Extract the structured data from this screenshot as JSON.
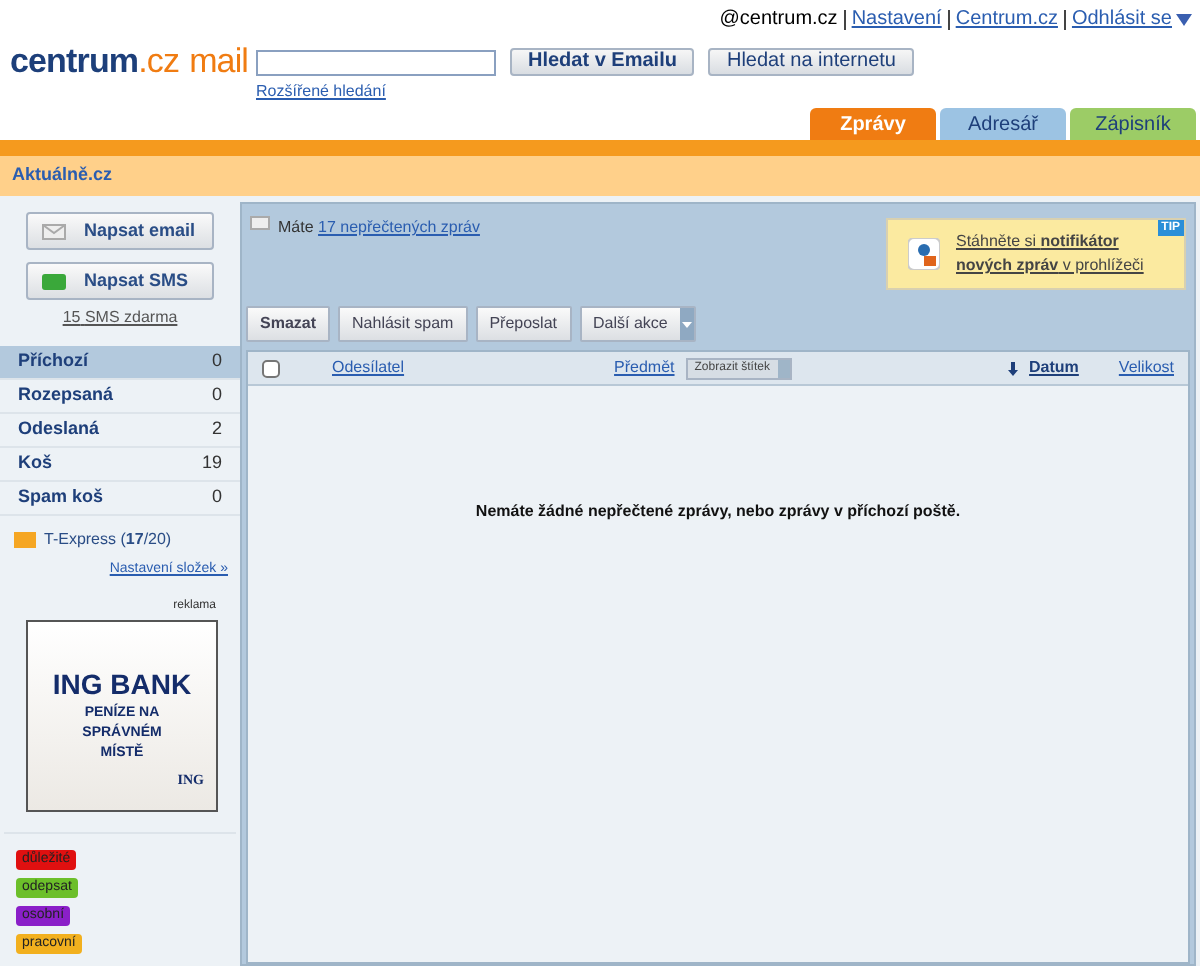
{
  "top_links": [
    {
      "label": "@centrum.cz",
      "kind": "account"
    },
    {
      "label": "Nastavení",
      "kind": "link"
    },
    {
      "label": "Centrum.cz",
      "kind": "link"
    },
    {
      "label": "Odhlásit se",
      "kind": "menu"
    }
  ],
  "logo": {
    "brand": "centrum",
    "domain": ".cz",
    "product": "mail"
  },
  "search": {
    "buttons": [
      "Hledat v Emailu",
      "Hledat na internetu"
    ],
    "advanced": "Rozšířené hledání"
  },
  "tabs": [
    {
      "label": "Zprávy",
      "selected": true,
      "color": "#f07c12"
    },
    {
      "label": "Adresář",
      "selected": false,
      "color": "#9cc3e3"
    },
    {
      "label": "Zápisník",
      "selected": false,
      "color": "#9ccc66"
    }
  ],
  "news_bar": "Aktuálně.cz",
  "compose": [
    {
      "label": "Napsat email",
      "kind": "email"
    },
    {
      "label": "Napsat SMS",
      "kind": "sms"
    }
  ],
  "sms_note": {
    "count": "15",
    "text": "SMS zdarma"
  },
  "folders": [
    {
      "name": "Příchozí",
      "count": "0",
      "selected": true
    },
    {
      "name": "Rozepsaná",
      "count": "0",
      "selected": false
    },
    {
      "name": "Odeslaná",
      "count": "2",
      "selected": false
    },
    {
      "name": "Koš",
      "count": "19",
      "selected": false
    },
    {
      "name": "Spam koš",
      "count": "0",
      "selected": false
    }
  ],
  "custom_folder": {
    "label": "T-Express (**17**/20)"
  },
  "folder_settings": "Nastavení složek »",
  "ad": {
    "label": "reklama",
    "title": "ING BANK",
    "subtitle": "PENÍZE NA SPRÁVNÉM MÍSTĚ",
    "logo": "ING"
  },
  "labels": [
    {
      "name": "důležité",
      "color": "#e01010"
    },
    {
      "name": "odepsat",
      "color": "#6cbf2a"
    },
    {
      "name": "osobní",
      "color": "#8a1fc8"
    },
    {
      "name": "pracovní",
      "color": "#f2b01e"
    }
  ],
  "unread_note": {
    "prefix": "Máte",
    "link": "17 nepřečtených zpráv"
  },
  "tip": {
    "badge": "TIP",
    "text": "Stáhněte si **notifikátor nových zpráv** v prohlížeči"
  },
  "actions": [
    {
      "label": "Smazat",
      "kind": "button"
    },
    {
      "label": "Nahlásit spam",
      "kind": "button"
    },
    {
      "label": "Přeposlat",
      "kind": "button"
    },
    {
      "label": "Další akce",
      "kind": "dropdown"
    }
  ],
  "table": {
    "select_all": false,
    "columns": [
      {
        "label": "Odesílatel",
        "kind": "sort"
      },
      {
        "label": "Předmět",
        "kind": "sort"
      },
      {
        "label": "Zobrazit štítek",
        "kind": "dropdown"
      },
      {
        "label": "Datum",
        "kind": "sorted"
      },
      {
        "label": "Velikost",
        "kind": "sort"
      }
    ],
    "empty_message": "Nemáte žádné nepřečtené zprávy, nebo zprávy v příchozí poště."
  }
}
